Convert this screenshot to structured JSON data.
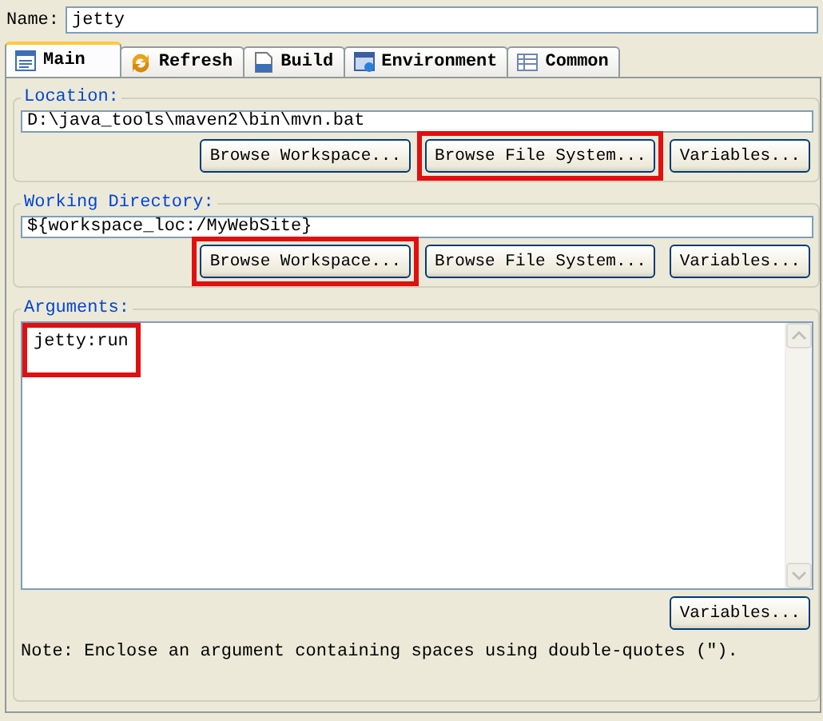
{
  "name_field": {
    "label": "Name:",
    "value": "jetty"
  },
  "tabs": [
    {
      "label": "Main",
      "selected": true
    },
    {
      "label": "Refresh",
      "selected": false
    },
    {
      "label": "Build",
      "selected": false
    },
    {
      "label": "Environment",
      "selected": false
    },
    {
      "label": "Common",
      "selected": false
    }
  ],
  "location": {
    "title": "Location:",
    "value": "D:\\java_tools\\maven2\\bin\\mvn.bat",
    "buttons": [
      {
        "label": "Browse Workspace...",
        "highlighted": false
      },
      {
        "label": "Browse File System...",
        "highlighted": true
      },
      {
        "label": "Variables...",
        "highlighted": false
      }
    ]
  },
  "working_directory": {
    "title": "Working Directory:",
    "value": "${workspace_loc:/MyWebSite}",
    "buttons": [
      {
        "label": "Browse Workspace...",
        "highlighted": true
      },
      {
        "label": "Browse File System...",
        "highlighted": false
      },
      {
        "label": "Variables...",
        "highlighted": false
      }
    ]
  },
  "arguments": {
    "title": "Arguments:",
    "value": "jetty:run",
    "highlighted": true,
    "buttons": [
      {
        "label": "Variables...",
        "highlighted": false
      }
    ],
    "note": "Note: Enclose an argument containing spaces using double-quotes (\")."
  }
}
